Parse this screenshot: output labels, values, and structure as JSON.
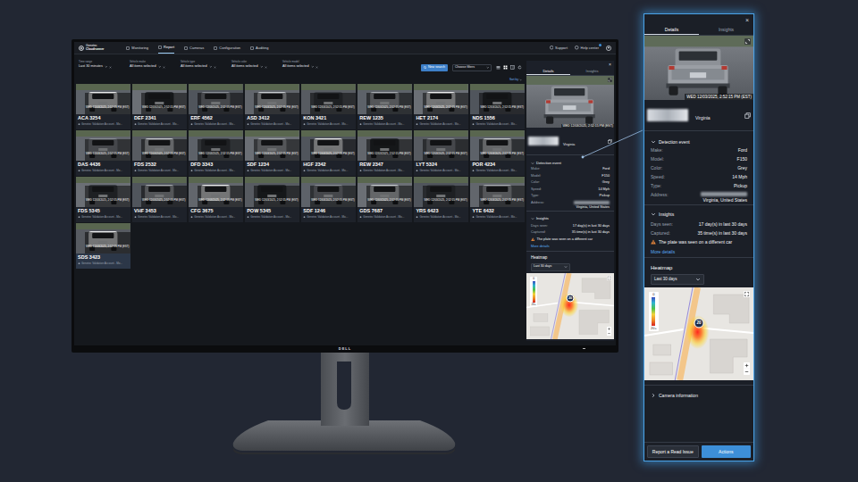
{
  "monitor": {
    "brand": "DELL",
    "app": {
      "logo": {
        "line1": "Genetec",
        "line2": "Cloudrunner"
      },
      "nav": [
        {
          "label": "Monitoring",
          "selected": false
        },
        {
          "label": "Report",
          "selected": true
        },
        {
          "label": "Cameras",
          "selected": false
        },
        {
          "label": "Configuration",
          "selected": false
        },
        {
          "label": "Auditing",
          "selected": false
        }
      ],
      "header_links": [
        {
          "label": "Support",
          "badge": false
        },
        {
          "label": "Help center",
          "badge": true
        }
      ],
      "filters": [
        {
          "label": "Time range",
          "value": "Last 30 minutes"
        },
        {
          "label": "Vehicle make",
          "value": "All items selected"
        },
        {
          "label": "Vehicle type",
          "value": "All items selected"
        },
        {
          "label": "Vehicle color",
          "value": "All items selected"
        },
        {
          "label": "Vehicle model",
          "value": "All items selected"
        }
      ],
      "new_search": "New search",
      "choose_filters": "Choose filters",
      "sort": "Sort by",
      "cards": [
        {
          "plate": "ACA 3254",
          "time": "WED 12/03/2025, 2:52:15 PM (EST)",
          "sub": "Genetec Validation Account - Mo...",
          "selected": false
        },
        {
          "plate": "DEF 2341",
          "time": "WED 12/03/2025, 2:52:15 PM (EST)",
          "sub": "Genetec Validation Account - Mo...",
          "selected": false
        },
        {
          "plate": "ERF 4562",
          "time": "WED 12/03/2025, 2:52:15 PM (EST)",
          "sub": "Genetec Validation Account - Mo...",
          "selected": false
        },
        {
          "plate": "ASD 3412",
          "time": "WED 12/03/2025, 2:52:15 PM (EST)",
          "sub": "Genetec Validation Account - Mo...",
          "selected": false
        },
        {
          "plate": "KON 3421",
          "time": "WED 12/03/2025, 2:52:15 PM (EST)",
          "sub": "Genetec Validation Account - Mo...",
          "selected": false
        },
        {
          "plate": "REW 1235",
          "time": "WED 12/03/2025, 2:52:15 PM (EST)",
          "sub": "Genetec Validation Account - Mo...",
          "selected": false
        },
        {
          "plate": "HET 2174",
          "time": "WED 12/03/2025, 2:52:15 PM (EST)",
          "sub": "Genetec Validation Account - Mo...",
          "selected": false
        },
        {
          "plate": "NDS 1556",
          "time": "WED 12/03/2025, 2:52:15 PM (EST)",
          "sub": "Genetec Validation Account - Mo...",
          "selected": false
        },
        {
          "plate": "DAS 4436",
          "time": "WED 12/03/2025, 2:52:15 PM (EST)",
          "sub": "Genetec Validation Account - Mo...",
          "selected": false
        },
        {
          "plate": "FDS 2532",
          "time": "WED 12/03/2025, 2:52:15 PM (EST)",
          "sub": "Genetec Validation Account - Mo...",
          "selected": false
        },
        {
          "plate": "DFD 3343",
          "time": "WED 12/03/2025, 2:52:15 PM (EST)",
          "sub": "Genetec Validation Account - Mo...",
          "selected": false
        },
        {
          "plate": "SDF 1234",
          "time": "WED 12/03/2025, 2:52:15 PM (EST)",
          "sub": "Genetec Validation Account - Mo...",
          "selected": false
        },
        {
          "plate": "HGF 2342",
          "time": "WED 12/03/2025, 2:52:15 PM (EST)",
          "sub": "Genetec Validation Account - Mo...",
          "selected": false
        },
        {
          "plate": "REW 2347",
          "time": "WED 12/03/2025, 2:52:15 PM (EST)",
          "sub": "Genetec Validation Account - Mo...",
          "selected": false
        },
        {
          "plate": "LYT 5324",
          "time": "WED 12/03/2025, 2:52:15 PM (EST)",
          "sub": "Genetec Validation Account - Mo...",
          "selected": false
        },
        {
          "plate": "POR 4234",
          "time": "WED 12/03/2025, 2:52:15 PM (EST)",
          "sub": "Genetec Validation Account - Mo...",
          "selected": false
        },
        {
          "plate": "FDS 5345",
          "time": "WED 12/03/2025, 2:52:15 PM (EST)",
          "sub": "Genetec Validation Account - Mo...",
          "selected": false
        },
        {
          "plate": "VHF 3453",
          "time": "WED 12/03/2025, 2:52:15 PM (EST)",
          "sub": "Genetec Validation Account - Mo...",
          "selected": false
        },
        {
          "plate": "CFG 3675",
          "time": "WED 12/03/2025, 2:52:15 PM (EST)",
          "sub": "Genetec Validation Account - Mo...",
          "selected": false
        },
        {
          "plate": "POW 5345",
          "time": "WED 12/03/2025, 2:52:15 PM (EST)",
          "sub": "Genetec Validation Account - Mo...",
          "selected": false
        },
        {
          "plate": "SDF 1246",
          "time": "WED 12/03/2025, 2:52:15 PM (EST)",
          "sub": "Genetec Validation Account - Mo...",
          "selected": false
        },
        {
          "plate": "GDS 7687",
          "time": "WED 12/03/2025, 2:52:15 PM (EST)",
          "sub": "Genetec Validation Account - Mo...",
          "selected": false
        },
        {
          "plate": "YRS 6423",
          "time": "WED 12/03/2025, 2:52:15 PM (EST)",
          "sub": "Genetec Validation Account - Mo...",
          "selected": false
        },
        {
          "plate": "YTE 6432",
          "time": "WED 12/03/2025, 2:52:15 PM (EST)",
          "sub": "Genetec Validation Account - Mo...",
          "selected": false
        },
        {
          "plate": "SDS 3423",
          "time": "WED 12/03/2025, 2:52:15 PM (EST)",
          "sub": "Genetec Validation Account - Mo...",
          "selected": true
        }
      ]
    }
  },
  "details": {
    "close": "×",
    "tabs": [
      {
        "label": "Details",
        "selected": true
      },
      {
        "label": "Insights",
        "selected": false
      }
    ],
    "timestamp": "WED 12/03/2025, 2:52:15 PM (EST)",
    "state": "Virginia",
    "detection": {
      "title": "Detection event",
      "expanded": true,
      "fields": [
        {
          "label": "Make:",
          "value": "Ford",
          "redacted": false
        },
        {
          "label": "Model:",
          "value": "F150",
          "redacted": false
        },
        {
          "label": "Color:",
          "value": "Grey",
          "redacted": false
        },
        {
          "label": "Speed:",
          "value": "14 Mph",
          "redacted": false
        },
        {
          "label": "Type:",
          "value": "Pickup",
          "redacted": false
        },
        {
          "label": "Address:",
          "value": "Virginia, United States",
          "redacted": true
        }
      ]
    },
    "insights": {
      "title": "Insights",
      "expanded": true,
      "fields": [
        {
          "label": "Days seen:",
          "value": "17 day(s) in last 30 days"
        },
        {
          "label": "Captured:",
          "value": "35 time(s) in last 30 days"
        }
      ],
      "warning": "The plate was seen on a different car",
      "more": "More details"
    },
    "heatmap": {
      "title": "Heatmap",
      "range": "Last 30 days",
      "scale": [
        "0",
        "20+"
      ],
      "marker": "20"
    },
    "camera": {
      "title": "Camera information",
      "expanded": false
    },
    "buttons": [
      {
        "label": "Report a Read Issue",
        "primary": false
      },
      {
        "label": "Actions",
        "primary": true
      }
    ]
  }
}
